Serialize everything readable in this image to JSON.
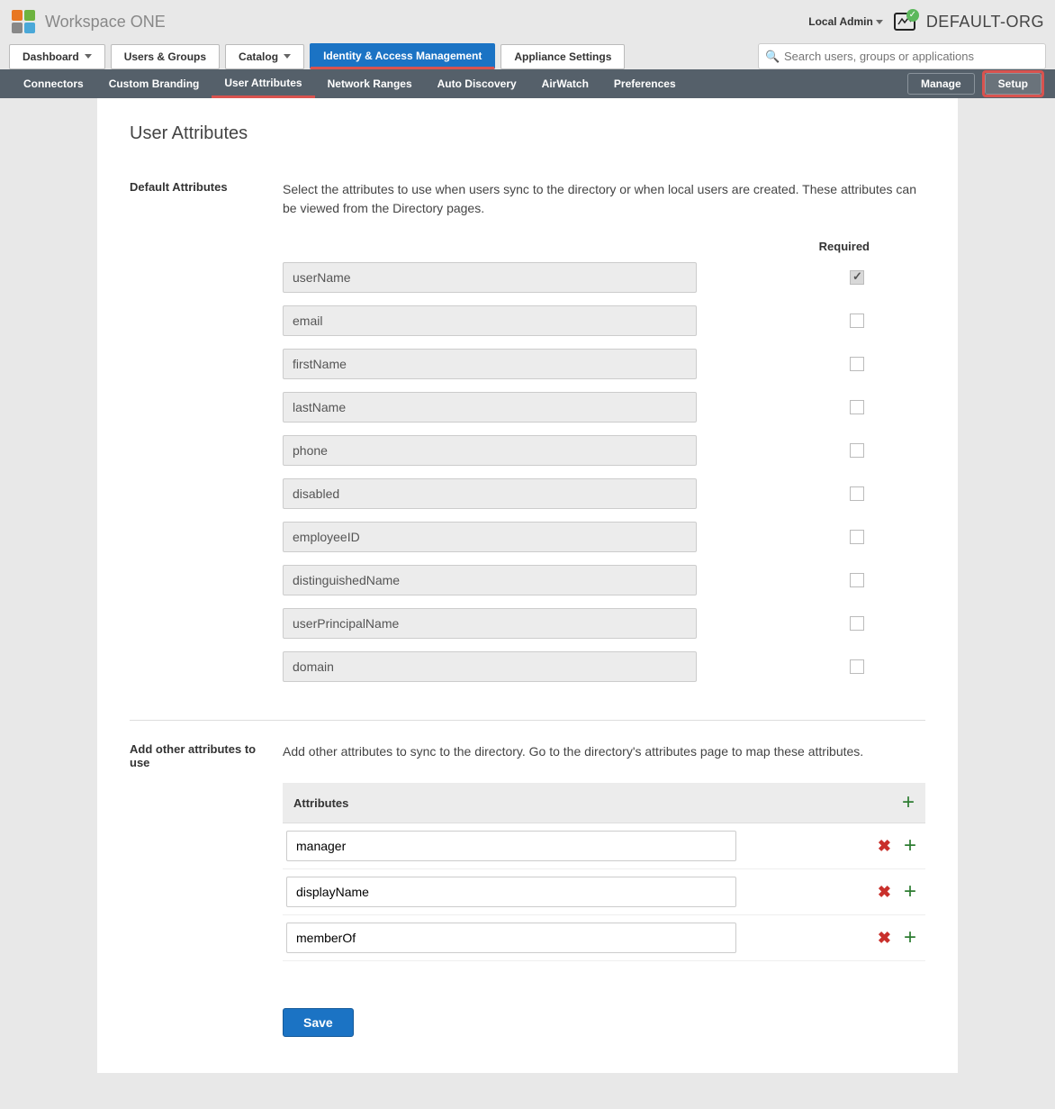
{
  "brand": "Workspace ONE",
  "user_menu": "Local Admin",
  "org_name": "DEFAULT-ORG",
  "main_tabs": {
    "dashboard": "Dashboard",
    "users_groups": "Users & Groups",
    "catalog": "Catalog",
    "iam": "Identity & Access Management",
    "appliance": "Appliance Settings"
  },
  "search_placeholder": "Search users, groups or applications",
  "subnav": {
    "connectors": "Connectors",
    "branding": "Custom Branding",
    "user_attributes": "User Attributes",
    "network": "Network Ranges",
    "auto_discovery": "Auto Discovery",
    "airwatch": "AirWatch",
    "preferences": "Preferences",
    "manage": "Manage",
    "setup": "Setup"
  },
  "page_title": "User Attributes",
  "default_section": {
    "label": "Default Attributes",
    "desc": "Select the attributes to use when users sync to the directory or when local users are created. These attributes can be viewed from the Directory pages.",
    "required_header": "Required",
    "attrs": [
      {
        "name": "userName",
        "required": true,
        "locked": true
      },
      {
        "name": "email",
        "required": false
      },
      {
        "name": "firstName",
        "required": false
      },
      {
        "name": "lastName",
        "required": false
      },
      {
        "name": "phone",
        "required": false
      },
      {
        "name": "disabled",
        "required": false
      },
      {
        "name": "employeeID",
        "required": false
      },
      {
        "name": "distinguishedName",
        "required": false
      },
      {
        "name": "userPrincipalName",
        "required": false
      },
      {
        "name": "domain",
        "required": false
      }
    ]
  },
  "custom_section": {
    "label": "Add other attributes to use",
    "desc": "Add other attributes to sync to the directory. Go to the directory's attributes page to map these attributes.",
    "header": "Attributes",
    "attrs": [
      {
        "name": "manager"
      },
      {
        "name": "displayName"
      },
      {
        "name": "memberOf"
      }
    ]
  },
  "save_label": "Save"
}
